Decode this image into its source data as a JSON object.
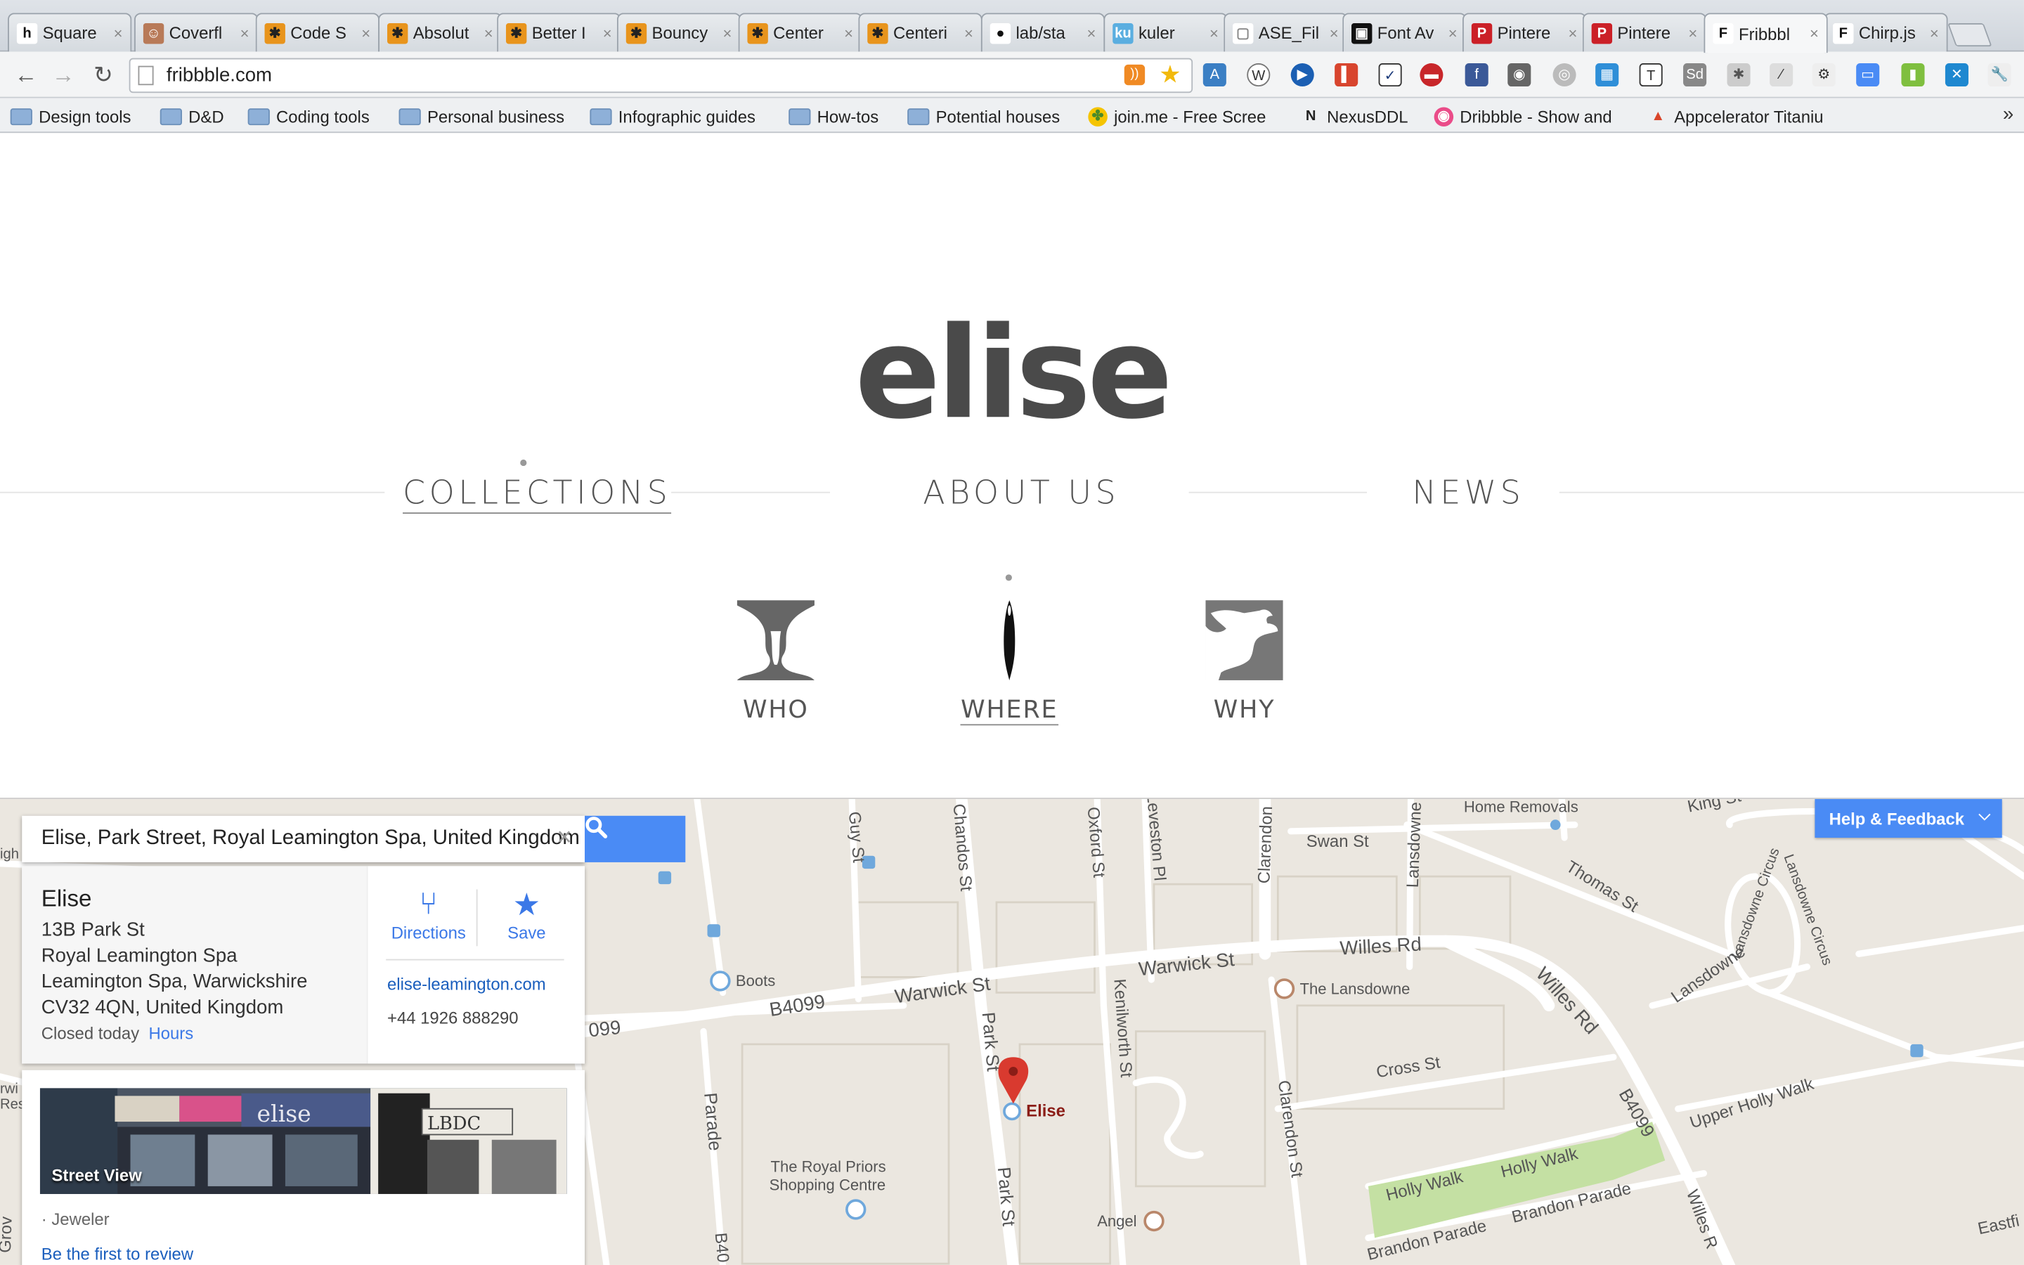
{
  "browser": {
    "tabs": [
      {
        "label": "Square",
        "fav": "h",
        "favbg": "#ffffff",
        "favfg": "#111111"
      },
      {
        "label": "Coverfl",
        "fav": "☺",
        "favbg": "#b87a58",
        "favfg": "#ffffff"
      },
      {
        "label": "Code S",
        "fav": "✱",
        "favbg": "#e8941c",
        "favfg": "#222222"
      },
      {
        "label": "Absolut",
        "fav": "✱",
        "favbg": "#e8941c",
        "favfg": "#222222"
      },
      {
        "label": "Better I",
        "fav": "✱",
        "favbg": "#e8941c",
        "favfg": "#222222"
      },
      {
        "label": "Bouncy",
        "fav": "✱",
        "favbg": "#e8941c",
        "favfg": "#222222"
      },
      {
        "label": "Center",
        "fav": "✱",
        "favbg": "#e8941c",
        "favfg": "#222222"
      },
      {
        "label": "Centeri",
        "fav": "✱",
        "favbg": "#e8941c",
        "favfg": "#222222"
      },
      {
        "label": "lab/sta",
        "fav": "●",
        "favbg": "#ffffff",
        "favfg": "#111111"
      },
      {
        "label": "kuler",
        "fav": "ku",
        "favbg": "#5aaee0",
        "favfg": "#ffffff"
      },
      {
        "label": "ASE_Fil",
        "fav": "▢",
        "favbg": "#ffffff",
        "favfg": "#888888"
      },
      {
        "label": "Font Av",
        "fav": "▣",
        "favbg": "#111111",
        "favfg": "#ffffff"
      },
      {
        "label": "Pintere",
        "fav": "P",
        "favbg": "#cb2027",
        "favfg": "#ffffff"
      },
      {
        "label": "Pintere",
        "fav": "P",
        "favbg": "#cb2027",
        "favfg": "#ffffff"
      },
      {
        "label": "Fribbbl",
        "fav": "F",
        "favbg": "#ffffff",
        "favfg": "#111111"
      },
      {
        "label": "Chirp.js",
        "fav": "F",
        "favbg": "#ffffff",
        "favfg": "#111111"
      }
    ],
    "close_glyph": "×",
    "url": "fribbble.com",
    "bookmarks": [
      {
        "label": "Design tools",
        "kind": "folder"
      },
      {
        "label": "D&D",
        "kind": "folder"
      },
      {
        "label": "Coding tools",
        "kind": "folder"
      },
      {
        "label": "Personal business",
        "kind": "folder"
      },
      {
        "label": "Infographic guides",
        "kind": "folder"
      },
      {
        "label": "How-tos",
        "kind": "folder"
      },
      {
        "label": "Potential houses",
        "kind": "folder"
      },
      {
        "label": "join.me - Free Scree",
        "kind": "link"
      },
      {
        "label": "NexusDDL",
        "kind": "link"
      },
      {
        "label": "Dribbble - Show and",
        "kind": "link"
      },
      {
        "label": "Appcelerator Titaniu",
        "kind": "link"
      }
    ],
    "bookmarks_more": "»"
  },
  "site": {
    "logo": "elise",
    "nav": {
      "collections": "COLLECTIONS",
      "about": "ABOUT US",
      "news": "NEWS"
    },
    "sub": {
      "who": "WHO",
      "where": "WHERE",
      "why": "WHY"
    }
  },
  "map": {
    "search_value": "Elise, Park Street, Royal Leamington Spa, United Kingdom",
    "clear_glyph": "×",
    "place": {
      "name": "Elise",
      "address": [
        "13B Park St",
        "Royal Leamington Spa",
        "Leamington Spa, Warwickshire",
        "CV32 4QN, United Kingdom"
      ],
      "status": "Closed today",
      "hours_link": "Hours",
      "directions": "Directions",
      "save": "Save",
      "website": "elise-leamington.com",
      "phone": "+44 1926 888290",
      "street_view": "Street View",
      "category": "· Jeweler",
      "review_link": "Be the first to review",
      "pin_label": "Elise"
    },
    "help": "Help & Feedback",
    "street_labels": {
      "guy": "Guy St",
      "chandos": "Chandos St",
      "oxford": "Oxford St",
      "leveston": "Leveston Pl",
      "clarendon_top": "Clarendon",
      "lansdowne": "Lansdowne",
      "home_removals": "Home Removals",
      "king": "King St",
      "swan": "Swan St",
      "thomas": "Thomas St",
      "lansdowne_circus": "Lansdowne Circus",
      "lansdowne_circus2": "Lansdowne Circus",
      "warwick1": "Warwick St",
      "warwick2": "Warwick St",
      "willes_rd": "Willes Rd",
      "willes_rd2": "Willes Rd",
      "b4099": "B4099",
      "b4099_2": "099",
      "boots": "Boots",
      "the_lansdowne": "The Lansdowne",
      "park1": "Park St",
      "park2": "Park St",
      "kenilworth": "Kenilworth St",
      "cross": "Cross St",
      "clarendon_st": "Clarendon St",
      "b4099_3": "B4099",
      "upper_holly": "Upper Holly Walk",
      "holly1": "Holly Walk",
      "holly2": "Holly Walk",
      "brandon1": "Brandon Parade",
      "brandon2": "Brandon Parade",
      "parade": "Parade",
      "royal_priors": "The Royal Priors",
      "shopping": "Shopping Centre",
      "angel": "Angel",
      "willes_s": "Willes R",
      "eastfi": "Eastfi",
      "b40": "B40",
      "nursing": "igh Nursing Home",
      "grov": "Grov",
      "rwi": "rwi",
      "res": "Res"
    }
  },
  "colors": {
    "accent": "#4a8bf5",
    "pin": "#d93a2f",
    "logo": "#4a4a4a"
  }
}
